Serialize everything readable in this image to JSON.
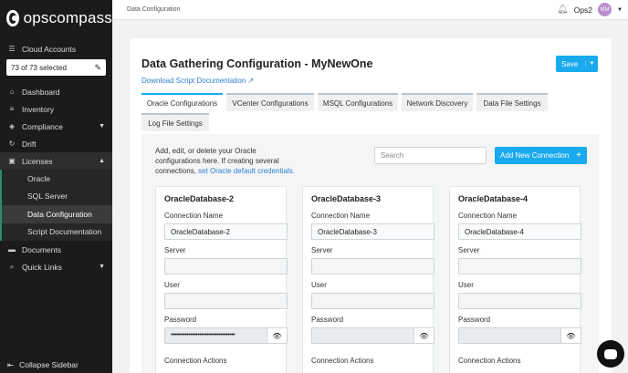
{
  "brand": {
    "name": "opscompass"
  },
  "sidebar": {
    "cloud_accounts_label": "Cloud Accounts",
    "selected_text": "73 of 73 selected",
    "items": [
      {
        "label": "Dashboard",
        "icon": "home-icon"
      },
      {
        "label": "Inventory",
        "icon": "stack-icon"
      },
      {
        "label": "Compliance",
        "icon": "shield-icon"
      },
      {
        "label": "Drift",
        "icon": "refresh-icon"
      },
      {
        "label": "Licenses",
        "icon": "briefcase-icon"
      },
      {
        "label": "Documents",
        "icon": "folder-icon"
      },
      {
        "label": "Quick Links",
        "icon": "search-icon"
      }
    ],
    "license_subitems": [
      "Oracle",
      "SQL Server",
      "Data Configuration",
      "Script Documentation"
    ],
    "collapse_label": "Collapse Sidebar"
  },
  "topbar": {
    "breadcrumb": "Data Configuration",
    "org": "Ops2",
    "avatar": "MM"
  },
  "page": {
    "title": "Data Gathering Configuration - MyNewOne",
    "doc_link": "Download Script Documentation",
    "save_label": "Save"
  },
  "tabs": [
    "Oracle Configurations",
    "VCenter Configurations",
    "MSQL Configurations",
    "Network Discovery",
    "Data File Settings",
    "Log File Settings"
  ],
  "panel": {
    "intro": "Add, edit, or delete your Oracle configurations here. If creating several connections, ",
    "intro_link": "set Oracle default credentials.",
    "search_placeholder": "Search",
    "add_label": "Add New Connection"
  },
  "field_labels": {
    "connection_name": "Connection Name",
    "server": "Server",
    "user": "User",
    "password": "Password",
    "connection_actions": "Connection Actions"
  },
  "connections": [
    {
      "title": "OracleDatabase-2",
      "connection_name": "OracleDatabase-2",
      "password_mask": "••••••••••••••••••••••••••••••••••••"
    },
    {
      "title": "OracleDatabase-3",
      "connection_name": "OracleDatabase-3",
      "password_mask": ""
    },
    {
      "title": "OracleDatabase-4",
      "connection_name": "OracleDatabase-4",
      "password_mask": ""
    }
  ],
  "colors": {
    "accent": "#19a9ee",
    "sidebar_bg": "#1b1b1b",
    "link": "#2e7fd3"
  }
}
